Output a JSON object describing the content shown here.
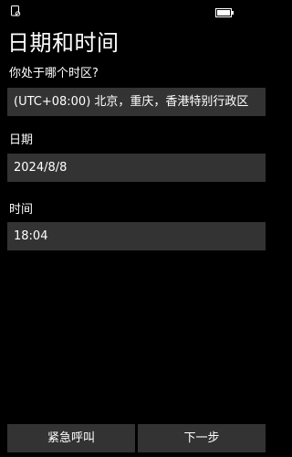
{
  "status_bar": {
    "left_icon": "phone-sim-icon",
    "right_icon": "battery-icon"
  },
  "page": {
    "title": "日期和时间"
  },
  "timezone": {
    "label": "你处于哪个时区?",
    "value": "(UTC+08:00) 北京，重庆，香港特别行政区"
  },
  "date": {
    "label": "日期",
    "value": "2024/8/8"
  },
  "time": {
    "label": "时间",
    "value": "18:04"
  },
  "buttons": {
    "emergency_label": "紧急呼叫",
    "next_label": "下一步"
  },
  "colors": {
    "background": "#000000",
    "field_background": "#333333",
    "text": "#ffffff"
  }
}
